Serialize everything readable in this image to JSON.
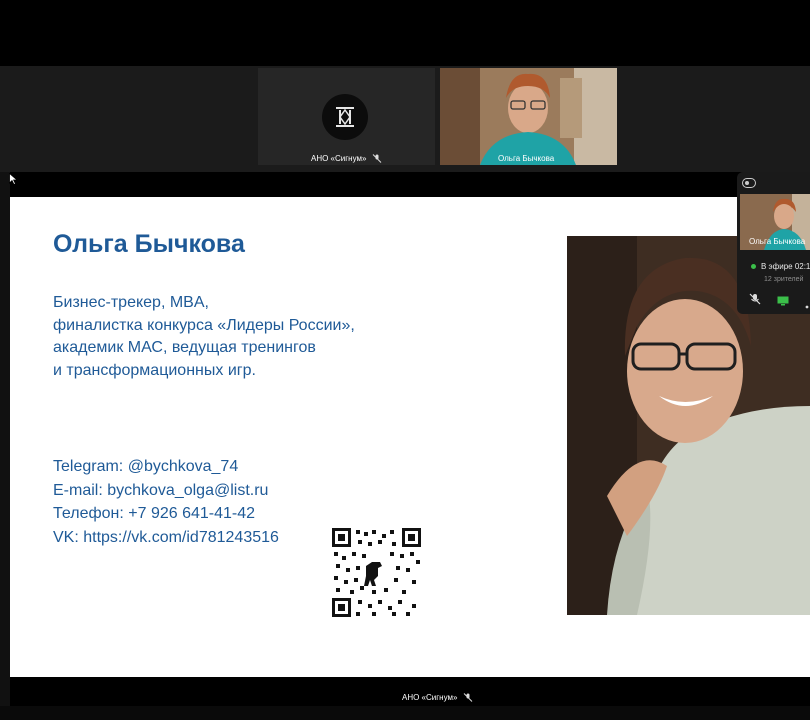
{
  "participants": [
    {
      "name": "АНО «Сигнум»",
      "mic": "muted"
    },
    {
      "name": "Ольга Бычкова",
      "mic": "on"
    }
  ],
  "slide": {
    "name": "Ольга Бычкова",
    "description": [
      "Бизнес-трекер, MBA,",
      "финалистка конкурса «Лидеры России»,",
      "академик МАС, ведущая тренингов",
      "и трансформационных игр."
    ],
    "contacts": [
      "Telegram: @bychkova_74",
      "E-mail: bychkova_olga@list.ru",
      "Телефон: +7 926 641-41-42",
      "VK: https://vk.com/id781243516"
    ]
  },
  "speaker_panel": {
    "name": "Ольга Бычкова",
    "live_status": "В эфире 02:1",
    "viewers": "12 зрителей"
  },
  "presenter_label": "АНО «Сигнум»",
  "colors": {
    "accent_text": "#1f5a97",
    "live": "#3bbf4a"
  }
}
